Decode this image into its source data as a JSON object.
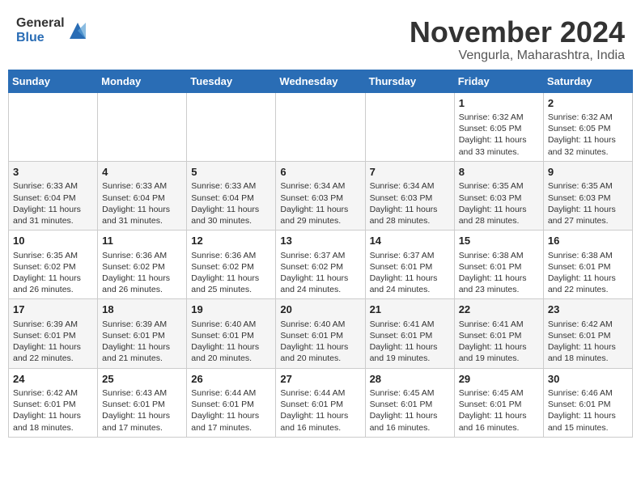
{
  "header": {
    "logo_general": "General",
    "logo_blue": "Blue",
    "month_title": "November 2024",
    "location": "Vengurla, Maharashtra, India"
  },
  "weekdays": [
    "Sunday",
    "Monday",
    "Tuesday",
    "Wednesday",
    "Thursday",
    "Friday",
    "Saturday"
  ],
  "weeks": [
    [
      {
        "day": "",
        "info": ""
      },
      {
        "day": "",
        "info": ""
      },
      {
        "day": "",
        "info": ""
      },
      {
        "day": "",
        "info": ""
      },
      {
        "day": "",
        "info": ""
      },
      {
        "day": "1",
        "info": "Sunrise: 6:32 AM\nSunset: 6:05 PM\nDaylight: 11 hours\nand 33 minutes."
      },
      {
        "day": "2",
        "info": "Sunrise: 6:32 AM\nSunset: 6:05 PM\nDaylight: 11 hours\nand 32 minutes."
      }
    ],
    [
      {
        "day": "3",
        "info": "Sunrise: 6:33 AM\nSunset: 6:04 PM\nDaylight: 11 hours\nand 31 minutes."
      },
      {
        "day": "4",
        "info": "Sunrise: 6:33 AM\nSunset: 6:04 PM\nDaylight: 11 hours\nand 31 minutes."
      },
      {
        "day": "5",
        "info": "Sunrise: 6:33 AM\nSunset: 6:04 PM\nDaylight: 11 hours\nand 30 minutes."
      },
      {
        "day": "6",
        "info": "Sunrise: 6:34 AM\nSunset: 6:03 PM\nDaylight: 11 hours\nand 29 minutes."
      },
      {
        "day": "7",
        "info": "Sunrise: 6:34 AM\nSunset: 6:03 PM\nDaylight: 11 hours\nand 28 minutes."
      },
      {
        "day": "8",
        "info": "Sunrise: 6:35 AM\nSunset: 6:03 PM\nDaylight: 11 hours\nand 28 minutes."
      },
      {
        "day": "9",
        "info": "Sunrise: 6:35 AM\nSunset: 6:03 PM\nDaylight: 11 hours\nand 27 minutes."
      }
    ],
    [
      {
        "day": "10",
        "info": "Sunrise: 6:35 AM\nSunset: 6:02 PM\nDaylight: 11 hours\nand 26 minutes."
      },
      {
        "day": "11",
        "info": "Sunrise: 6:36 AM\nSunset: 6:02 PM\nDaylight: 11 hours\nand 26 minutes."
      },
      {
        "day": "12",
        "info": "Sunrise: 6:36 AM\nSunset: 6:02 PM\nDaylight: 11 hours\nand 25 minutes."
      },
      {
        "day": "13",
        "info": "Sunrise: 6:37 AM\nSunset: 6:02 PM\nDaylight: 11 hours\nand 24 minutes."
      },
      {
        "day": "14",
        "info": "Sunrise: 6:37 AM\nSunset: 6:01 PM\nDaylight: 11 hours\nand 24 minutes."
      },
      {
        "day": "15",
        "info": "Sunrise: 6:38 AM\nSunset: 6:01 PM\nDaylight: 11 hours\nand 23 minutes."
      },
      {
        "day": "16",
        "info": "Sunrise: 6:38 AM\nSunset: 6:01 PM\nDaylight: 11 hours\nand 22 minutes."
      }
    ],
    [
      {
        "day": "17",
        "info": "Sunrise: 6:39 AM\nSunset: 6:01 PM\nDaylight: 11 hours\nand 22 minutes."
      },
      {
        "day": "18",
        "info": "Sunrise: 6:39 AM\nSunset: 6:01 PM\nDaylight: 11 hours\nand 21 minutes."
      },
      {
        "day": "19",
        "info": "Sunrise: 6:40 AM\nSunset: 6:01 PM\nDaylight: 11 hours\nand 20 minutes."
      },
      {
        "day": "20",
        "info": "Sunrise: 6:40 AM\nSunset: 6:01 PM\nDaylight: 11 hours\nand 20 minutes."
      },
      {
        "day": "21",
        "info": "Sunrise: 6:41 AM\nSunset: 6:01 PM\nDaylight: 11 hours\nand 19 minutes."
      },
      {
        "day": "22",
        "info": "Sunrise: 6:41 AM\nSunset: 6:01 PM\nDaylight: 11 hours\nand 19 minutes."
      },
      {
        "day": "23",
        "info": "Sunrise: 6:42 AM\nSunset: 6:01 PM\nDaylight: 11 hours\nand 18 minutes."
      }
    ],
    [
      {
        "day": "24",
        "info": "Sunrise: 6:42 AM\nSunset: 6:01 PM\nDaylight: 11 hours\nand 18 minutes."
      },
      {
        "day": "25",
        "info": "Sunrise: 6:43 AM\nSunset: 6:01 PM\nDaylight: 11 hours\nand 17 minutes."
      },
      {
        "day": "26",
        "info": "Sunrise: 6:44 AM\nSunset: 6:01 PM\nDaylight: 11 hours\nand 17 minutes."
      },
      {
        "day": "27",
        "info": "Sunrise: 6:44 AM\nSunset: 6:01 PM\nDaylight: 11 hours\nand 16 minutes."
      },
      {
        "day": "28",
        "info": "Sunrise: 6:45 AM\nSunset: 6:01 PM\nDaylight: 11 hours\nand 16 minutes."
      },
      {
        "day": "29",
        "info": "Sunrise: 6:45 AM\nSunset: 6:01 PM\nDaylight: 11 hours\nand 16 minutes."
      },
      {
        "day": "30",
        "info": "Sunrise: 6:46 AM\nSunset: 6:01 PM\nDaylight: 11 hours\nand 15 minutes."
      }
    ]
  ]
}
